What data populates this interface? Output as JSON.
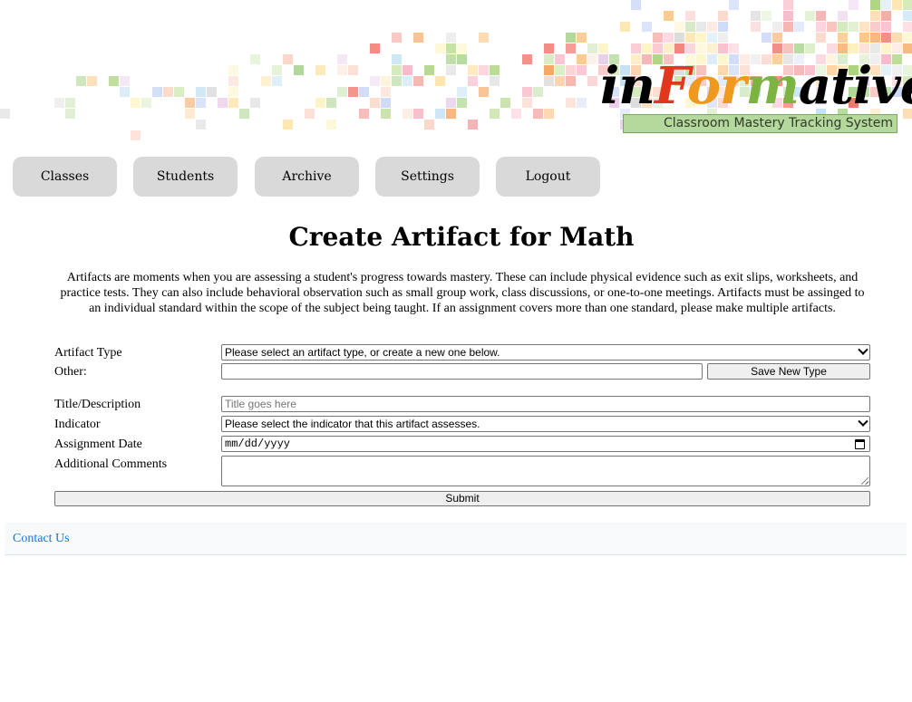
{
  "logo": {
    "word_parts": [
      "in",
      "F",
      "or",
      "m",
      "ative"
    ],
    "tagline": "Classroom Mastery Tracking System",
    "colors": {
      "black": "#000000",
      "red": "#e2371c",
      "orange": "#ef9a1f",
      "green": "#7cb342",
      "tag_bg": "#b5d99c"
    }
  },
  "nav": {
    "classes": "Classes",
    "students": "Students",
    "archive": "Archive",
    "settings": "Settings",
    "logout": "Logout"
  },
  "page": {
    "title": "Create Artifact for Math",
    "intro": "Artifacts are moments when you are assessing a student's progress towards mastery. These can include physical evidence such as exit slips, worksheets, and practice tests. They can also include behavioral observation such as small group work, class discussions, or one-to-one meetings. Artifacts must be assinged to an individual standard within the scope of the subject being taught. If an assignment covers more than one standard, please make multiple artifacts."
  },
  "form": {
    "artifact_type_label": "Artifact Type",
    "artifact_type_selected": "Please select an artifact type, or create a new one below.",
    "other_label": "Other:",
    "other_value": "",
    "save_new_type_button": "Save New Type",
    "title_label": "Title/Description",
    "title_placeholder": "Title goes here",
    "indicator_label": "Indicator",
    "indicator_selected": "Please select the indicator that this artifact assesses.",
    "date_label": "Assignment Date",
    "date_placeholder": "mm/dd/yyyy",
    "comments_label": "Additional Comments",
    "comments_value": "",
    "submit_button": "Submit"
  },
  "footer": {
    "contact_link": "Contact Us",
    "link_color": "#1a73c9"
  }
}
